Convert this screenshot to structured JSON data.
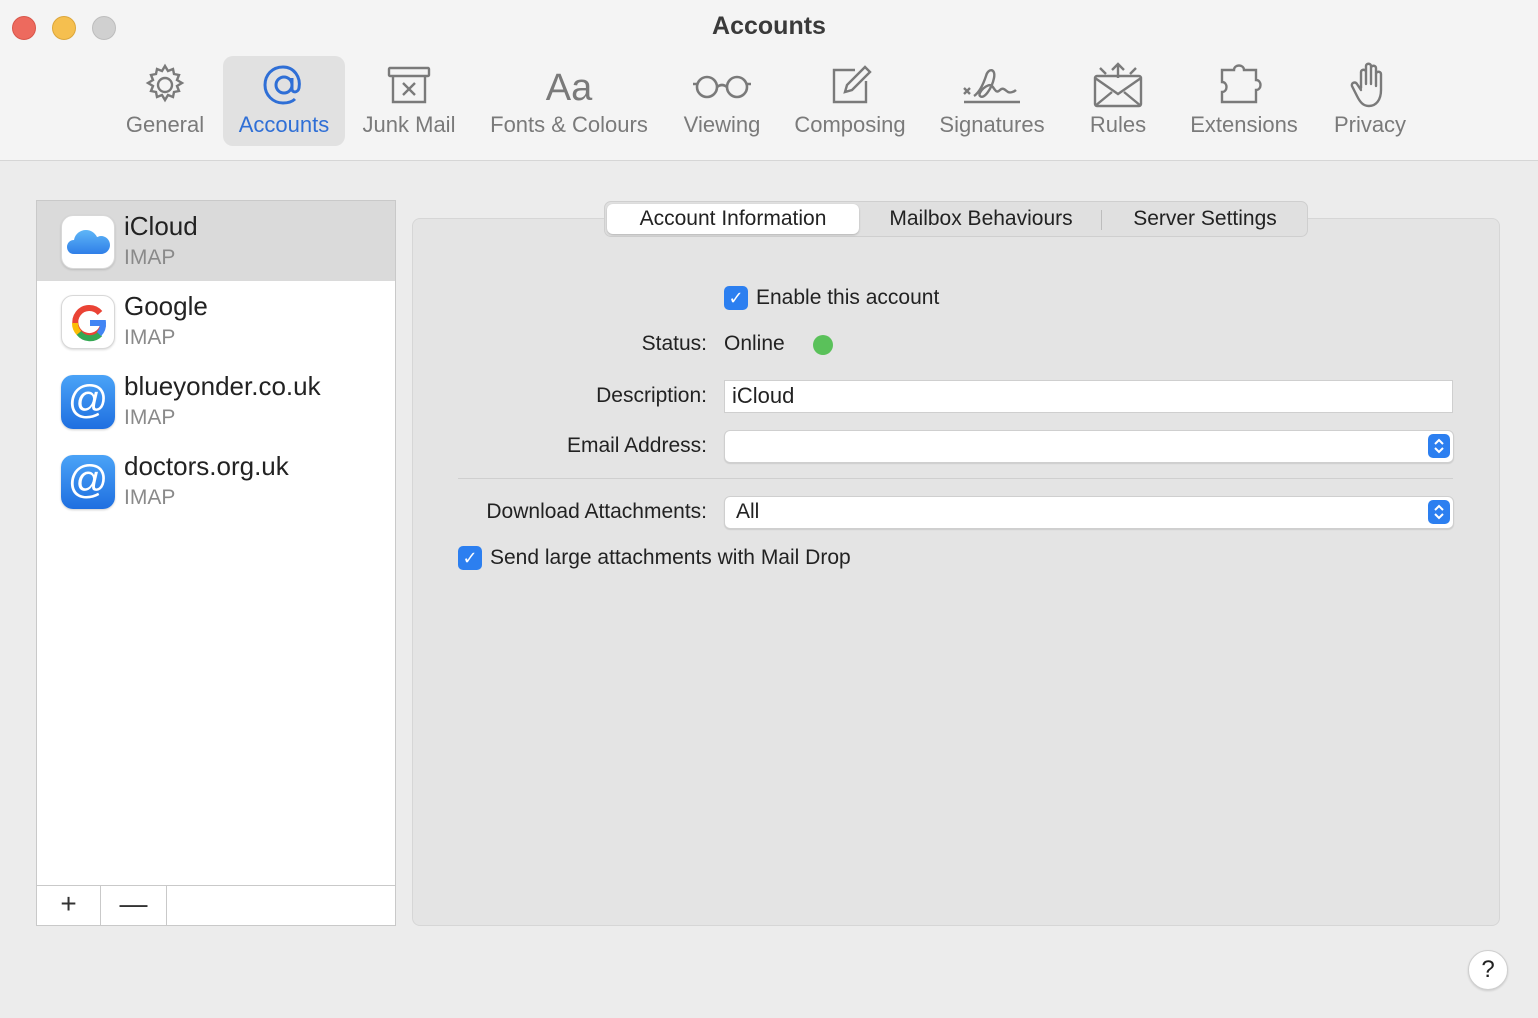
{
  "window": {
    "title": "Accounts"
  },
  "toolbar": {
    "items": [
      {
        "label": "General",
        "icon": "gear-icon",
        "active": false
      },
      {
        "label": "Accounts",
        "icon": "at-sign-icon",
        "active": true
      },
      {
        "label": "Junk Mail",
        "icon": "junk-mail-icon",
        "active": false
      },
      {
        "label": "Fonts & Colours",
        "icon": "fonts-icon",
        "active": false
      },
      {
        "label": "Viewing",
        "icon": "glasses-icon",
        "active": false
      },
      {
        "label": "Composing",
        "icon": "compose-icon",
        "active": false
      },
      {
        "label": "Signatures",
        "icon": "signature-icon",
        "active": false
      },
      {
        "label": "Rules",
        "icon": "rules-envelope-icon",
        "active": false
      },
      {
        "label": "Extensions",
        "icon": "puzzle-icon",
        "active": false
      },
      {
        "label": "Privacy",
        "icon": "hand-icon",
        "active": false
      }
    ],
    "accent": "#2f6fd6"
  },
  "accounts": {
    "items": [
      {
        "name": "iCloud",
        "type": "IMAP",
        "icon": "icloud-icon",
        "selected": true
      },
      {
        "name": "Google",
        "type": "IMAP",
        "icon": "google-icon",
        "selected": false
      },
      {
        "name": "blueyonder.co.uk",
        "type": "IMAP",
        "icon": "at-sign-icon",
        "selected": false
      },
      {
        "name": "doctors.org.uk",
        "type": "IMAP",
        "icon": "at-sign-icon",
        "selected": false
      }
    ],
    "add_label": "+",
    "remove_label": "—"
  },
  "tabs": [
    {
      "label": "Account Information",
      "active": true
    },
    {
      "label": "Mailbox Behaviours",
      "active": false
    },
    {
      "label": "Server Settings",
      "active": false
    }
  ],
  "form": {
    "enable_account": {
      "label": "Enable this account",
      "checked": true
    },
    "status": {
      "label": "Status:",
      "value": "Online",
      "color": "#5ac15a"
    },
    "description": {
      "label": "Description:",
      "value": "iCloud"
    },
    "email": {
      "label": "Email Address:",
      "value": ""
    },
    "download_attachments": {
      "label": "Download Attachments:",
      "value": "All"
    },
    "mail_drop": {
      "label": "Send large attachments with Mail Drop",
      "checked": true
    }
  },
  "help": {
    "label": "?"
  }
}
